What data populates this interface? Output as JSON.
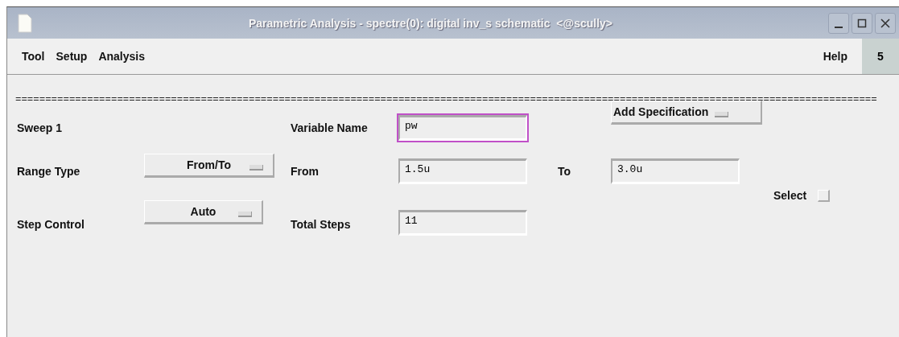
{
  "window": {
    "title": "Parametric Analysis - spectre(0): digital inv_s schematic  <@scully>"
  },
  "menu": {
    "items": [
      "Tool",
      "Setup",
      "Analysis"
    ],
    "help": "Help",
    "badge": "5"
  },
  "separator": "================================================================================================================================================",
  "sweep": {
    "label": "Sweep 1",
    "variable_label": "Variable Name",
    "variable": {
      "value": "pw",
      "focused": true
    },
    "add_button": "Add Specification"
  },
  "range": {
    "label": "Range Type",
    "dropdown": "From/To",
    "from_label": "From",
    "from": {
      "value": "1.5u",
      "focused": false
    },
    "to_label": "To",
    "to": {
      "value": "3.0u",
      "focused": false
    }
  },
  "step": {
    "label": "Step Control",
    "dropdown": "Auto",
    "steps_label": "Total Steps",
    "steps": {
      "value": "11",
      "focused": false
    }
  },
  "select": {
    "label": "Select",
    "checked": false
  }
}
